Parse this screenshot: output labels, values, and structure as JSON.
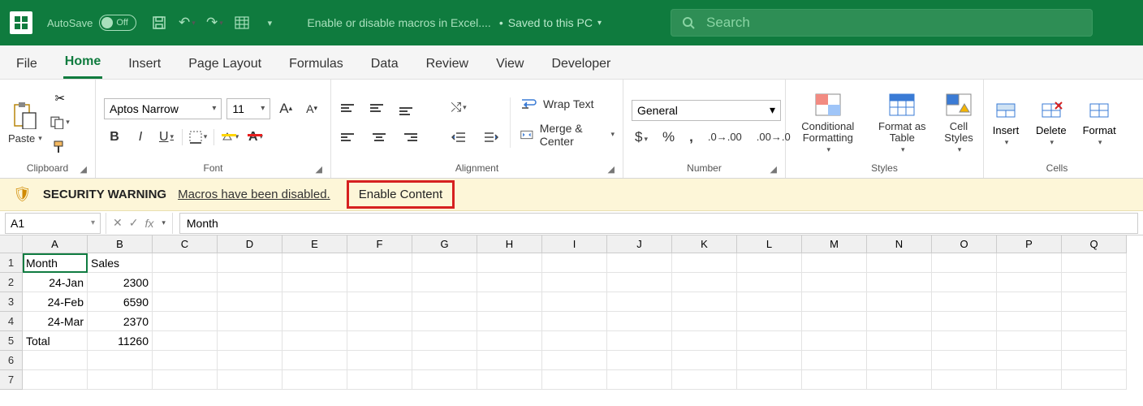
{
  "titlebar": {
    "autosave_label": "AutoSave",
    "autosave_state": "Off",
    "doc_title": "Enable or disable macros in Excel....",
    "saved_status": "Saved to this PC",
    "search_placeholder": "Search"
  },
  "tabs": [
    "File",
    "Home",
    "Insert",
    "Page Layout",
    "Formulas",
    "Data",
    "Review",
    "View",
    "Developer"
  ],
  "active_tab": "Home",
  "ribbon": {
    "clipboard": {
      "paste": "Paste",
      "label": "Clipboard"
    },
    "font": {
      "name": "Aptos Narrow",
      "size": "11",
      "label": "Font"
    },
    "alignment": {
      "wrap": "Wrap Text",
      "merge": "Merge & Center",
      "label": "Alignment"
    },
    "number": {
      "format": "General",
      "label": "Number"
    },
    "styles": {
      "cond": "Conditional Formatting",
      "table": "Format as Table",
      "cell": "Cell Styles",
      "label": "Styles"
    },
    "cells": {
      "insert": "Insert",
      "delete": "Delete",
      "format": "Format",
      "label": "Cells"
    }
  },
  "security": {
    "title": "SECURITY WARNING",
    "msg": "Macros have been disabled.",
    "button": "Enable Content"
  },
  "formula_bar": {
    "namebox": "A1",
    "content": "Month"
  },
  "columns": [
    "A",
    "B",
    "C",
    "D",
    "E",
    "F",
    "G",
    "H",
    "I",
    "J",
    "K",
    "L",
    "M",
    "N",
    "O",
    "P",
    "Q"
  ],
  "rows": [
    {
      "n": "1",
      "A": "Month",
      "B": "Sales"
    },
    {
      "n": "2",
      "A": "24-Jan",
      "B": "2300"
    },
    {
      "n": "3",
      "A": "24-Feb",
      "B": "6590"
    },
    {
      "n": "4",
      "A": "24-Mar",
      "B": "2370"
    },
    {
      "n": "5",
      "A": "Total",
      "B": "11260"
    },
    {
      "n": "6"
    },
    {
      "n": "7"
    }
  ],
  "selected_cell": "A1"
}
